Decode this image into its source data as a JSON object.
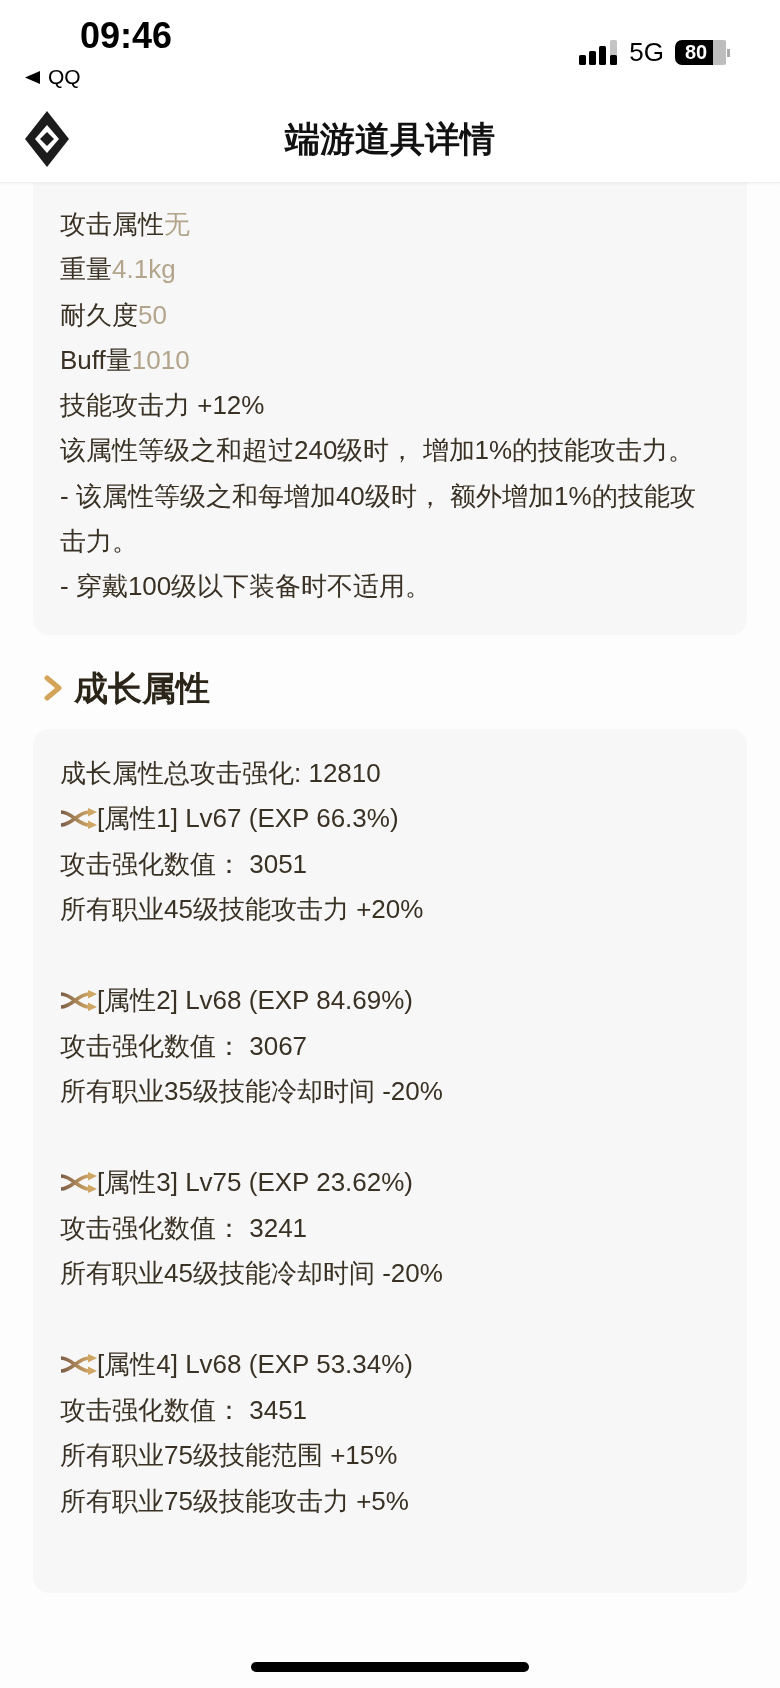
{
  "status_bar": {
    "time": "09:46",
    "back_label": "QQ",
    "network": "5G",
    "battery": "80"
  },
  "header": {
    "title": "端游道具详情"
  },
  "basic_card": {
    "attributes": [
      {
        "label": "攻击属性",
        "value": "无"
      },
      {
        "label": "重量",
        "value": "4.1kg"
      },
      {
        "label": "耐久度",
        "value": "50"
      },
      {
        "label": "Buff量",
        "value": "1010"
      }
    ],
    "lines": [
      "技能攻击力 +12%",
      "该属性等级之和超过240级时， 增加1%的技能攻击力。",
      "- 该属性等级之和每增加40级时， 额外增加1%的技能攻击力。",
      "- 穿戴100级以下装备时不适用。"
    ]
  },
  "growth_section": {
    "title": "成长属性",
    "total": "成长属性总攻击强化: 12810",
    "properties": [
      {
        "name": "[属性1] Lv67 (EXP 66.3%)",
        "value_line": "攻击强化数值： 3051",
        "effects": [
          "所有职业45级技能攻击力 +20%"
        ]
      },
      {
        "name": "[属性2] Lv68 (EXP 84.69%)",
        "value_line": "攻击强化数值： 3067",
        "effects": [
          "所有职业35级技能冷却时间 -20%"
        ]
      },
      {
        "name": "[属性3] Lv75 (EXP 23.62%)",
        "value_line": "攻击强化数值： 3241",
        "effects": [
          "所有职业45级技能冷却时间 -20%"
        ]
      },
      {
        "name": "[属性4] Lv68 (EXP 53.34%)",
        "value_line": "攻击强化数值： 3451",
        "effects": [
          "所有职业75级技能范围 +15%",
          "所有职业75级技能攻击力 +5%"
        ]
      }
    ]
  }
}
